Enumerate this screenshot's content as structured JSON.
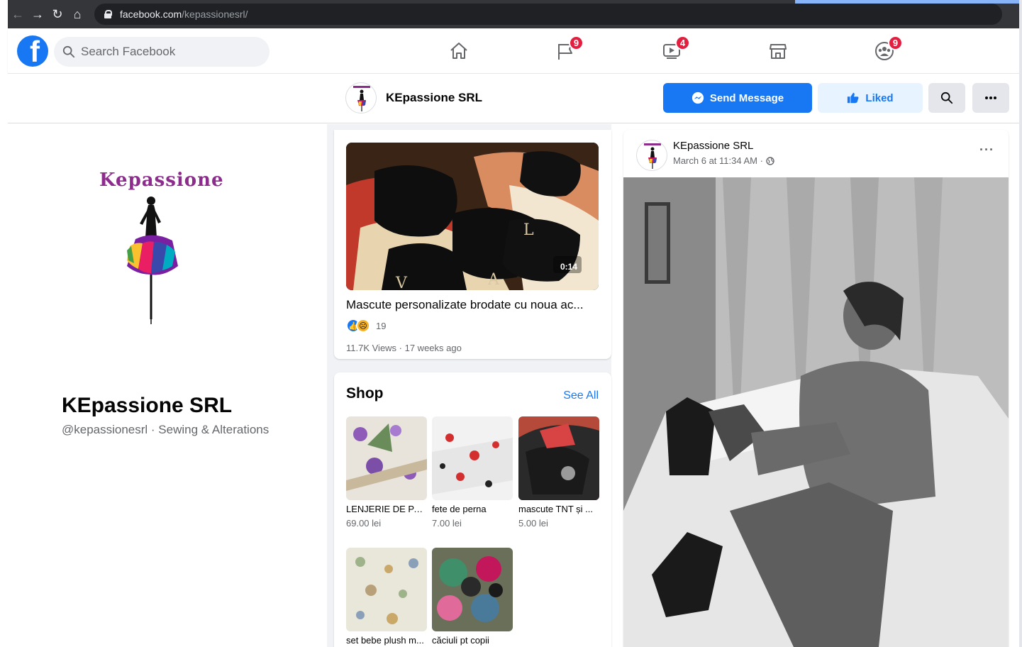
{
  "browser": {
    "url_host": "facebook.com",
    "url_path": "/kepassionesrl/"
  },
  "fb_nav": {
    "search_placeholder": "Search Facebook",
    "pages_badge": "9",
    "watch_badge": "4",
    "groups_badge": "9"
  },
  "page_header": {
    "name": "KEpassione SRL",
    "send_message_label": "Send Message",
    "liked_label": "Liked"
  },
  "profile": {
    "brand_wordmark": "Kepassione",
    "name": "KEpassione SRL",
    "subtitle": "@kepassionesrl · Sewing & Alterations"
  },
  "video": {
    "duration": "0:14",
    "title": "Mascute personalizate brodate cu noua ac...",
    "reaction_count": "19",
    "meta": "11.7K Views · 17 weeks ago"
  },
  "shop": {
    "title": "Shop",
    "see_all": "See All",
    "products": [
      {
        "name": "LENJERIE DE PAT ...",
        "price": "69.00 lei"
      },
      {
        "name": "fete de perna",
        "price": "7.00 lei"
      },
      {
        "name": "mascute TNT și ...",
        "price": "5.00 lei"
      },
      {
        "name": "set bebe plush m...",
        "price": ""
      },
      {
        "name": "căciuli pt copii",
        "price": ""
      }
    ]
  },
  "post": {
    "author": "KEpassione SRL",
    "time": "March 6 at 11:34 AM ·",
    "more": "···"
  },
  "colors": {
    "fb_blue": "#1877f2",
    "badge_red": "#e41e3f",
    "brand_purple": "#8e2c8e"
  }
}
